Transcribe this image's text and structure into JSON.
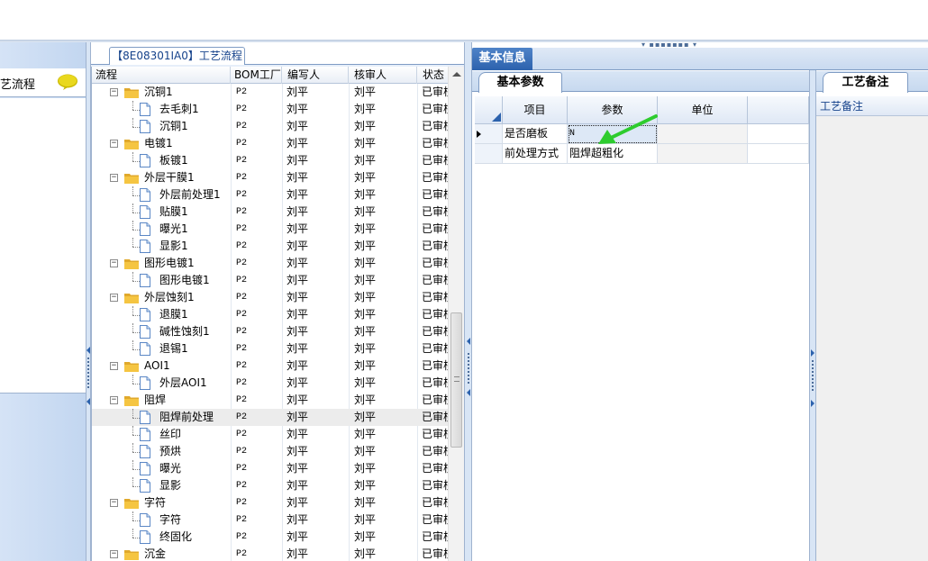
{
  "left_panel": {
    "title": "艺流程",
    "icon": "speech-bubble-icon"
  },
  "process_tab": {
    "label": "【8E08301IA0】工艺流程"
  },
  "columns": [
    "流程",
    "BOM工厂",
    "编写人",
    "核审人",
    "状态"
  ],
  "rows": [
    {
      "level": 0,
      "name": "沉铜1",
      "bom": "P2",
      "author": "刘平",
      "reviewer": "刘平",
      "status": "已审核"
    },
    {
      "level": 1,
      "name": "去毛刺1",
      "bom": "P2",
      "author": "刘平",
      "reviewer": "刘平",
      "status": "已审核"
    },
    {
      "level": 1,
      "name": "沉铜1",
      "bom": "P2",
      "author": "刘平",
      "reviewer": "刘平",
      "status": "已审核"
    },
    {
      "level": 0,
      "name": "电镀1",
      "bom": "P2",
      "author": "刘平",
      "reviewer": "刘平",
      "status": "已审核"
    },
    {
      "level": 1,
      "name": "板镀1",
      "bom": "P2",
      "author": "刘平",
      "reviewer": "刘平",
      "status": "已审核"
    },
    {
      "level": 0,
      "name": "外层干膜1",
      "bom": "P2",
      "author": "刘平",
      "reviewer": "刘平",
      "status": "已审核"
    },
    {
      "level": 1,
      "name": "外层前处理1",
      "bom": "P2",
      "author": "刘平",
      "reviewer": "刘平",
      "status": "已审核"
    },
    {
      "level": 1,
      "name": "贴膜1",
      "bom": "P2",
      "author": "刘平",
      "reviewer": "刘平",
      "status": "已审核"
    },
    {
      "level": 1,
      "name": "曝光1",
      "bom": "P2",
      "author": "刘平",
      "reviewer": "刘平",
      "status": "已审核"
    },
    {
      "level": 1,
      "name": "显影1",
      "bom": "P2",
      "author": "刘平",
      "reviewer": "刘平",
      "status": "已审核"
    },
    {
      "level": 0,
      "name": "图形电镀1",
      "bom": "P2",
      "author": "刘平",
      "reviewer": "刘平",
      "status": "已审核"
    },
    {
      "level": 1,
      "name": "图形电镀1",
      "bom": "P2",
      "author": "刘平",
      "reviewer": "刘平",
      "status": "已审核"
    },
    {
      "level": 0,
      "name": "外层蚀刻1",
      "bom": "P2",
      "author": "刘平",
      "reviewer": "刘平",
      "status": "已审核"
    },
    {
      "level": 1,
      "name": "退膜1",
      "bom": "P2",
      "author": "刘平",
      "reviewer": "刘平",
      "status": "已审核"
    },
    {
      "level": 1,
      "name": "碱性蚀刻1",
      "bom": "P2",
      "author": "刘平",
      "reviewer": "刘平",
      "status": "已审核"
    },
    {
      "level": 1,
      "name": "退锡1",
      "bom": "P2",
      "author": "刘平",
      "reviewer": "刘平",
      "status": "已审核"
    },
    {
      "level": 0,
      "name": "AOI1",
      "bom": "P2",
      "author": "刘平",
      "reviewer": "刘平",
      "status": "已审核"
    },
    {
      "level": 1,
      "name": "外层AOI1",
      "bom": "P2",
      "author": "刘平",
      "reviewer": "刘平",
      "status": "已审核"
    },
    {
      "level": 0,
      "name": "阻焊",
      "bom": "P2",
      "author": "刘平",
      "reviewer": "刘平",
      "status": "已审核"
    },
    {
      "level": 1,
      "name": "阻焊前处理",
      "bom": "P2",
      "author": "刘平",
      "reviewer": "刘平",
      "status": "已审核",
      "selected": true
    },
    {
      "level": 1,
      "name": "丝印",
      "bom": "P2",
      "author": "刘平",
      "reviewer": "刘平",
      "status": "已审核"
    },
    {
      "level": 1,
      "name": "预烘",
      "bom": "P2",
      "author": "刘平",
      "reviewer": "刘平",
      "status": "已审核"
    },
    {
      "level": 1,
      "name": "曝光",
      "bom": "P2",
      "author": "刘平",
      "reviewer": "刘平",
      "status": "已审核"
    },
    {
      "level": 1,
      "name": "显影",
      "bom": "P2",
      "author": "刘平",
      "reviewer": "刘平",
      "status": "已审核"
    },
    {
      "level": 0,
      "name": "字符",
      "bom": "P2",
      "author": "刘平",
      "reviewer": "刘平",
      "status": "已审核"
    },
    {
      "level": 1,
      "name": "字符",
      "bom": "P2",
      "author": "刘平",
      "reviewer": "刘平",
      "status": "已审核"
    },
    {
      "level": 1,
      "name": "终固化",
      "bom": "P2",
      "author": "刘平",
      "reviewer": "刘平",
      "status": "已审核"
    },
    {
      "level": 0,
      "name": "沉金",
      "bom": "P2",
      "author": "刘平",
      "reviewer": "刘平",
      "status": "已审核"
    }
  ],
  "info_tab": {
    "label": "基本信息"
  },
  "params_tab": {
    "label": "基本参数"
  },
  "param_columns": [
    "项目",
    "参数",
    "单位"
  ],
  "param_rows": [
    {
      "item": "是否磨板",
      "value": "N",
      "unit": ""
    },
    {
      "item": "前处理方式",
      "value": "阻焊超粗化",
      "unit": ""
    }
  ],
  "remark_tab": {
    "label": "工艺备注"
  },
  "remark_header": "工艺备注",
  "colors": {
    "accent": "#2c62ad",
    "annotation_arrow": "#2ecc2e",
    "folder": "#f5c542"
  }
}
